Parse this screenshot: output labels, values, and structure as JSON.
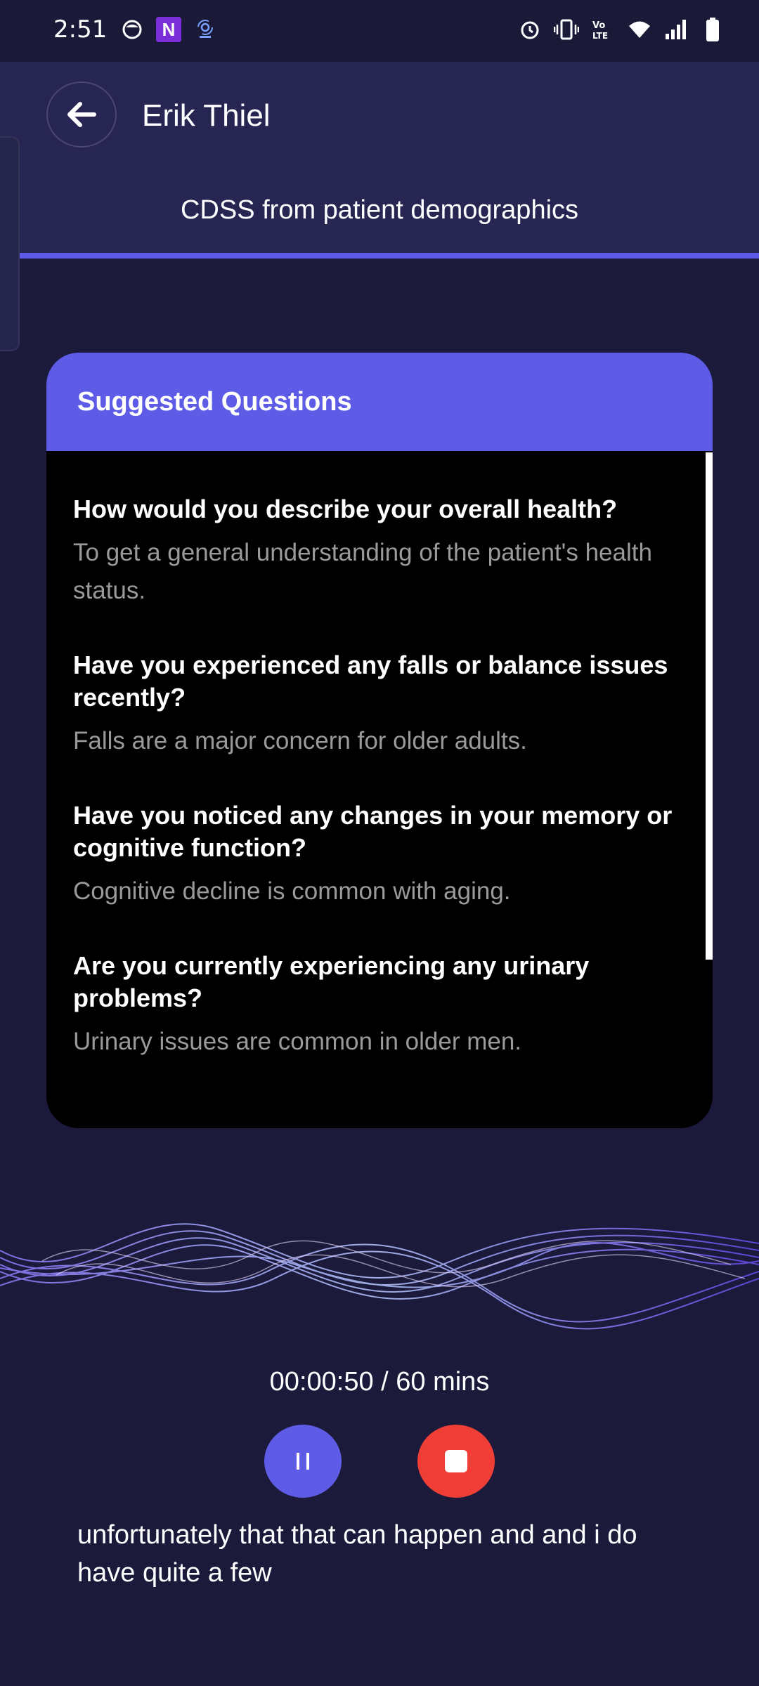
{
  "status_bar": {
    "time": "2:51",
    "left_icons": [
      "face-icon",
      "n-app-icon",
      "podcast-icon"
    ],
    "right_icons": [
      "alarm-icon",
      "vibrate-icon",
      "volte-icon",
      "wifi-icon",
      "signal-icon",
      "battery-icon"
    ]
  },
  "header": {
    "back_icon": "arrow-left-icon",
    "patient_name": "Erik Thiel",
    "subtitle": "CDSS from patient demographics",
    "accent_color": "#5e5ce6"
  },
  "card": {
    "title": "Suggested Questions",
    "questions": [
      {
        "question": "How would you describe your overall health?",
        "description": "To get a general understanding of the patient's health status."
      },
      {
        "question": "Have you experienced any falls or balance issues recently?",
        "description": "Falls are a major concern for older adults."
      },
      {
        "question": "Have you noticed any changes in your memory or cognitive function?",
        "description": "Cognitive decline is common with aging."
      },
      {
        "question": "Are you currently experiencing any urinary problems?",
        "description": "Urinary issues are common in older men."
      }
    ]
  },
  "recording": {
    "timer": "00:00:50 / 60 mins",
    "pause_icon": "pause-icon",
    "stop_icon": "stop-icon",
    "stop_color": "#ef3e36",
    "transcript": "unfortunately that that can happen and and i do have quite a few"
  }
}
